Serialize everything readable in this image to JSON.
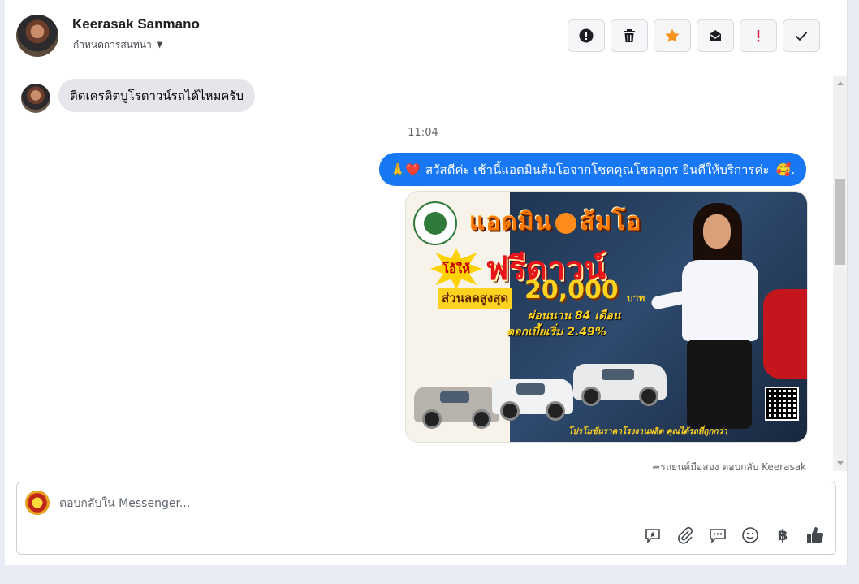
{
  "header": {
    "user_name": "Keerasak Sanmano",
    "assign_label": "กำหนดการสนทนา"
  },
  "actions": [
    {
      "name": "report-spam",
      "icon": "alert-circle-icon"
    },
    {
      "name": "delete",
      "icon": "trash-icon"
    },
    {
      "name": "star",
      "icon": "star-icon"
    },
    {
      "name": "mark-unread",
      "icon": "envelope-icon"
    },
    {
      "name": "follow-up",
      "icon": "exclamation-icon"
    },
    {
      "name": "done",
      "icon": "check-icon"
    }
  ],
  "colors": {
    "outgoing_bubble": "#1877f2",
    "incoming_bubble": "#e4e6eb",
    "star": "#f7931e",
    "follow_up": "#e41e3f"
  },
  "messages": {
    "incoming_text": "ติดเครดิตบูโรดาวน์รถได้ไหมครับ",
    "timestamp": "11:04",
    "outgoing_emoji": "🙏❤️",
    "outgoing_text": "สวัสดีค่ะ เช้านี้แอดมินส้มโอจากโชคคุณโชคอุดร ยินดีให้บริการค่ะ",
    "outgoing_suffix": "🥰.",
    "sent_note": "รถยนต์มือสอง ตอบกลับ Keerasak"
  },
  "promo": {
    "headline_left": "แอดมิน",
    "headline_right": "ส้มโอ",
    "burst_text": "โอ้ให้",
    "free_text": "ฟรีดาวน์",
    "discount_label": "ส่วนลดสูงสุด",
    "amount": "20,000",
    "currency": "บาท",
    "installment": "ผ่อนนาน 84 เดือน",
    "interest": "ดอกเบี้ยเริ่ม 2.49%",
    "footer": "โปรโมชั่นราคาโรงงานผลิต คุณได้รถที่ถูกกว่า"
  },
  "composer": {
    "placeholder": "ตอบกลับใน Messenger...",
    "tools": [
      "saved-reply-icon",
      "attachment-icon",
      "chat-bubbles-icon",
      "emoji-icon",
      "baht-icon",
      "thumbs-up-icon"
    ]
  }
}
